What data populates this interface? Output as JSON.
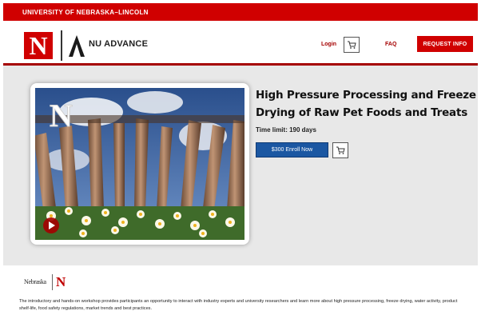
{
  "topbar": {
    "title": "UNIVERSITY OF NEBRASKA–LINCOLN"
  },
  "header": {
    "logo_letter": "N",
    "brand": "NU ADVANCE",
    "nav": {
      "login": "Login",
      "faq": "FAQ",
      "request_info": "REQUEST INFO"
    }
  },
  "course": {
    "title": "High Pressure Processing and Freeze Drying of Raw Pet Foods and Treats",
    "time_limit": "Time limit: 190 days",
    "enroll_label": "$300 Enroll Now",
    "image_logo_letter": "N"
  },
  "footer": {
    "logo_text": "Nebraska",
    "logo_letter": "N",
    "description": "The introductory and hands-on workshop provides participants an opportunity to interact with industry experts and university researchers and learn more about high pressure processing, freeze drying, water activity, product shelf-life, food safety regulations, market trends and best practices."
  },
  "colors": {
    "brand_red": "#d00000",
    "enroll_blue": "#1b57a2",
    "main_bg": "#e8e8e8"
  },
  "icons": [
    "cart-icon",
    "nu-advance-logo-icon",
    "play-icon"
  ]
}
